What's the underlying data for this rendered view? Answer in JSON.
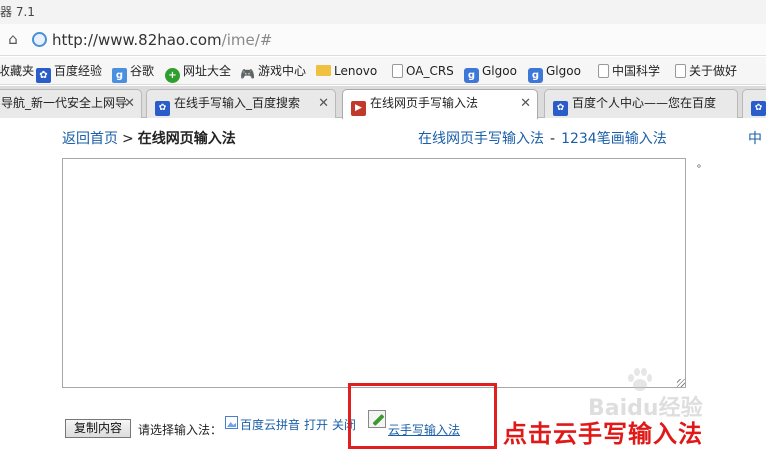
{
  "window": {
    "title": "器 7.1"
  },
  "address_bar": {
    "url_host": "http://www.82hao.com",
    "url_path": "/ime/#"
  },
  "bookmarks": [
    {
      "label": "收藏夹",
      "icon": "none"
    },
    {
      "label": "百度经验",
      "icon": "baidu-paw-icon"
    },
    {
      "label": "谷歌",
      "icon": "google-icon"
    },
    {
      "label": "网址大全",
      "icon": "hao-icon"
    },
    {
      "label": "游戏中心",
      "icon": "gamepad-icon"
    },
    {
      "label": "Lenovo",
      "icon": "folder-icon"
    },
    {
      "label": "OA_CRS",
      "icon": "page-icon"
    },
    {
      "label": "Glgoo",
      "icon": "glgoo-icon"
    },
    {
      "label": "Glgoo",
      "icon": "glgoo-icon"
    },
    {
      "label": "中国科学",
      "icon": "page-icon"
    },
    {
      "label": "关于做好",
      "icon": "page-icon"
    }
  ],
  "tabs": [
    {
      "label": "导航_新一代安全上网导",
      "active": false,
      "icon": "none"
    },
    {
      "label": "在线手写输入_百度搜索",
      "active": false,
      "icon": "baidu-paw-icon"
    },
    {
      "label": "在线网页手写输入法",
      "active": true,
      "icon": "site-icon"
    },
    {
      "label": "百度个人中心——您在百度",
      "active": false,
      "icon": "baidu-paw-icon"
    },
    {
      "label": "",
      "active": false,
      "icon": "baidu-paw-icon"
    }
  ],
  "page": {
    "breadcrumb_home": "返回首页",
    "breadcrumb_sep": ">",
    "breadcrumb_current": "在线网页输入法",
    "top_links": [
      "在线网页手写输入法",
      "1234笔画输入法"
    ],
    "top_link_sep": "-",
    "cut_link": "中",
    "dot_mark": "。",
    "copy_button": "复制内容",
    "choose_label": "请选择输入法：",
    "pinyin_link": "百度云拼音",
    "pinyin_open": "打开",
    "pinyin_close": "关闭",
    "handwriting_link": "云手写输入法",
    "callout": "点击云手写输入法"
  },
  "watermark": {
    "text": "Baidu经验"
  },
  "colors": {
    "link": "#1a5fa8",
    "highlight": "#e02020",
    "callout": "#e01818"
  }
}
